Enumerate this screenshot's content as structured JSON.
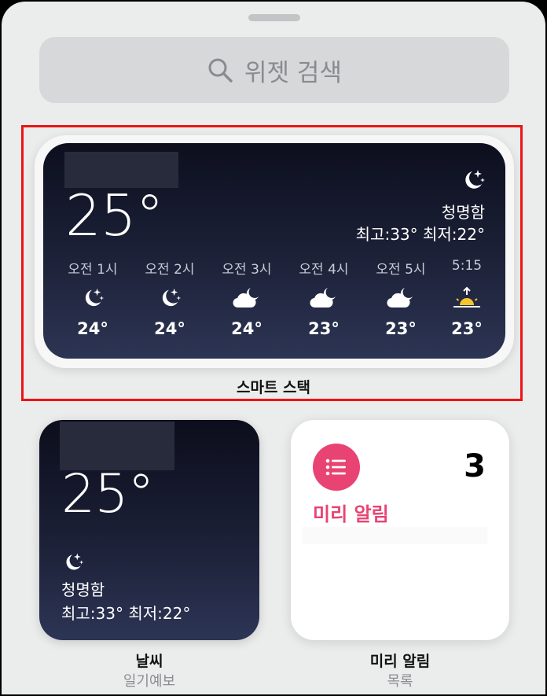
{
  "search": {
    "placeholder": "위젯 검색"
  },
  "smart_stack": {
    "label": "스마트 스택",
    "widget": {
      "temperature": "25°",
      "condition": "청명함",
      "hilo": "최고:33° 최저:22°",
      "hourly": [
        {
          "time": "오전 1시",
          "icon": "moon-stars-icon",
          "temp": "24°"
        },
        {
          "time": "오전 2시",
          "icon": "moon-stars-icon",
          "temp": "24°"
        },
        {
          "time": "오전 3시",
          "icon": "cloud-moon-icon",
          "temp": "24°"
        },
        {
          "time": "오전 4시",
          "icon": "cloud-moon-icon",
          "temp": "23°"
        },
        {
          "time": "오전 5시",
          "icon": "cloud-moon-icon",
          "temp": "23°"
        },
        {
          "time": "5:15",
          "icon": "sunrise-icon",
          "temp": "23°"
        }
      ]
    }
  },
  "weather_widget": {
    "temperature": "25°",
    "condition": "청명함",
    "hilo": "최고:33° 최저:22°",
    "name": "날씨",
    "subtitle": "일기예보"
  },
  "reminders_widget": {
    "count": "3",
    "title": "미리 알림",
    "name": "미리 알림",
    "subtitle": "목록",
    "accent_color": "#e84373"
  },
  "colors": {
    "highlight_border": "#ef1313",
    "sheet_background": "#ebecec"
  }
}
